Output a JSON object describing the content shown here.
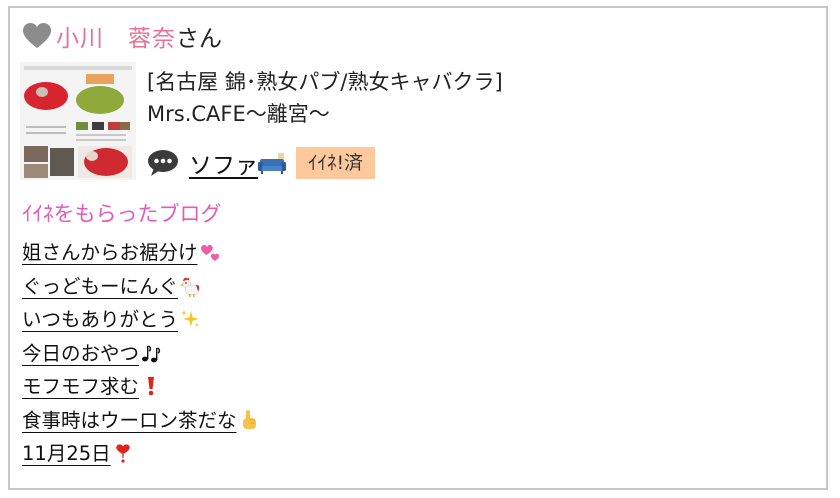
{
  "header": {
    "name": "小川　蓉奈",
    "suffix": "さん",
    "icon": "heart-icon"
  },
  "shop": {
    "line1": "[名古屋 錦･熟女パブ/熟女キャバクラ]",
    "line2": "Mrs.CAFE～離宮～"
  },
  "item": {
    "title": "ソファ",
    "title_icon": "sofa-icon",
    "badge": "ｲｲﾈ!済",
    "icon": "speech-bubble-icon"
  },
  "section": {
    "title": "ｲｲﾈをもらったブログ"
  },
  "blogs": [
    {
      "title": "姐さんからお裾分け",
      "icon": "two-hearts-icon"
    },
    {
      "title": "ぐっどもーにんぐ",
      "icon": "rooster-icon"
    },
    {
      "title": "いつもありがとう",
      "icon": "sparkles-icon"
    },
    {
      "title": "今日のおやつ",
      "icon": "music-notes-icon"
    },
    {
      "title": "モフモフ求む",
      "icon": "exclamation-icon"
    },
    {
      "title": "食事時はウーロン茶だな",
      "icon": "pointing-up-icon"
    },
    {
      "title": "11月25日",
      "icon": "heart-exclamation-icon"
    }
  ],
  "colors": {
    "name": "#e86f96",
    "section_title": "#e35bb8",
    "badge_bg": "#fcc89c",
    "border": "#c8c8c8"
  }
}
